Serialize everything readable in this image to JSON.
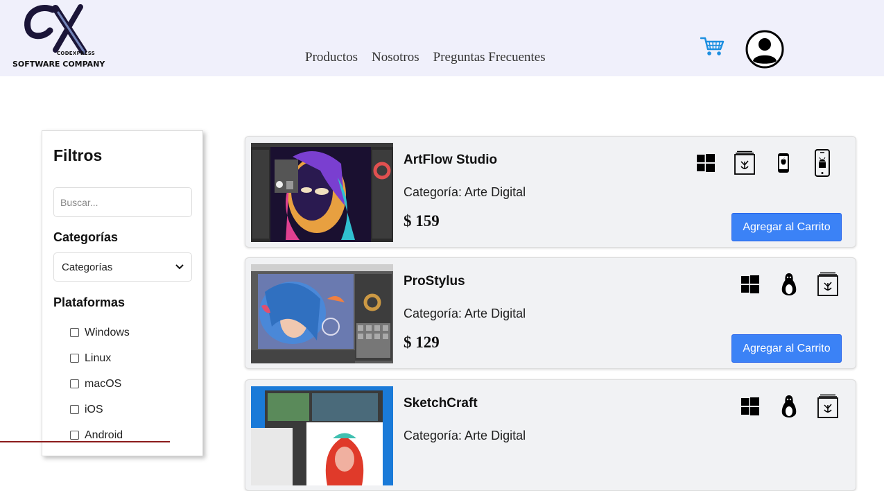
{
  "brand": {
    "small_text": "CODEXPRESS",
    "company": "SOFTWARE COMPANY"
  },
  "nav": {
    "items": [
      "Productos",
      "Nosotros",
      "Preguntas Frecuentes"
    ]
  },
  "header_icons": [
    "cart-icon",
    "user-icon"
  ],
  "colors": {
    "header_bg": "#f0f0fb",
    "accent_blue": "#3b82f6",
    "cart_blue": "#1d8fe0",
    "card_bg": "#f1f2f4"
  },
  "filters": {
    "title": "Filtros",
    "search_placeholder": "Buscar...",
    "categories_title": "Categorías",
    "categories_selected": "Categorías",
    "platforms_title": "Plataformas",
    "platforms": [
      "Windows",
      "Linux",
      "macOS",
      "iOS",
      "Android"
    ]
  },
  "products": [
    {
      "name": "ArtFlow Studio",
      "category": "Categoría: Arte Digital",
      "price": "$ 159",
      "button": "Agregar al Carrito",
      "platforms": [
        "windows-icon",
        "macos-icon",
        "ios-icon",
        "android-icon"
      ]
    },
    {
      "name": "ProStylus",
      "category": "Categoría: Arte Digital",
      "price": "$ 129",
      "button": "Agregar al Carrito",
      "platforms": [
        "windows-icon",
        "linux-icon",
        "macos-icon"
      ]
    },
    {
      "name": "SketchCraft",
      "category": "Categoría: Arte Digital",
      "price": "",
      "button": "",
      "platforms": [
        "windows-icon",
        "linux-icon",
        "macos-icon"
      ]
    }
  ]
}
